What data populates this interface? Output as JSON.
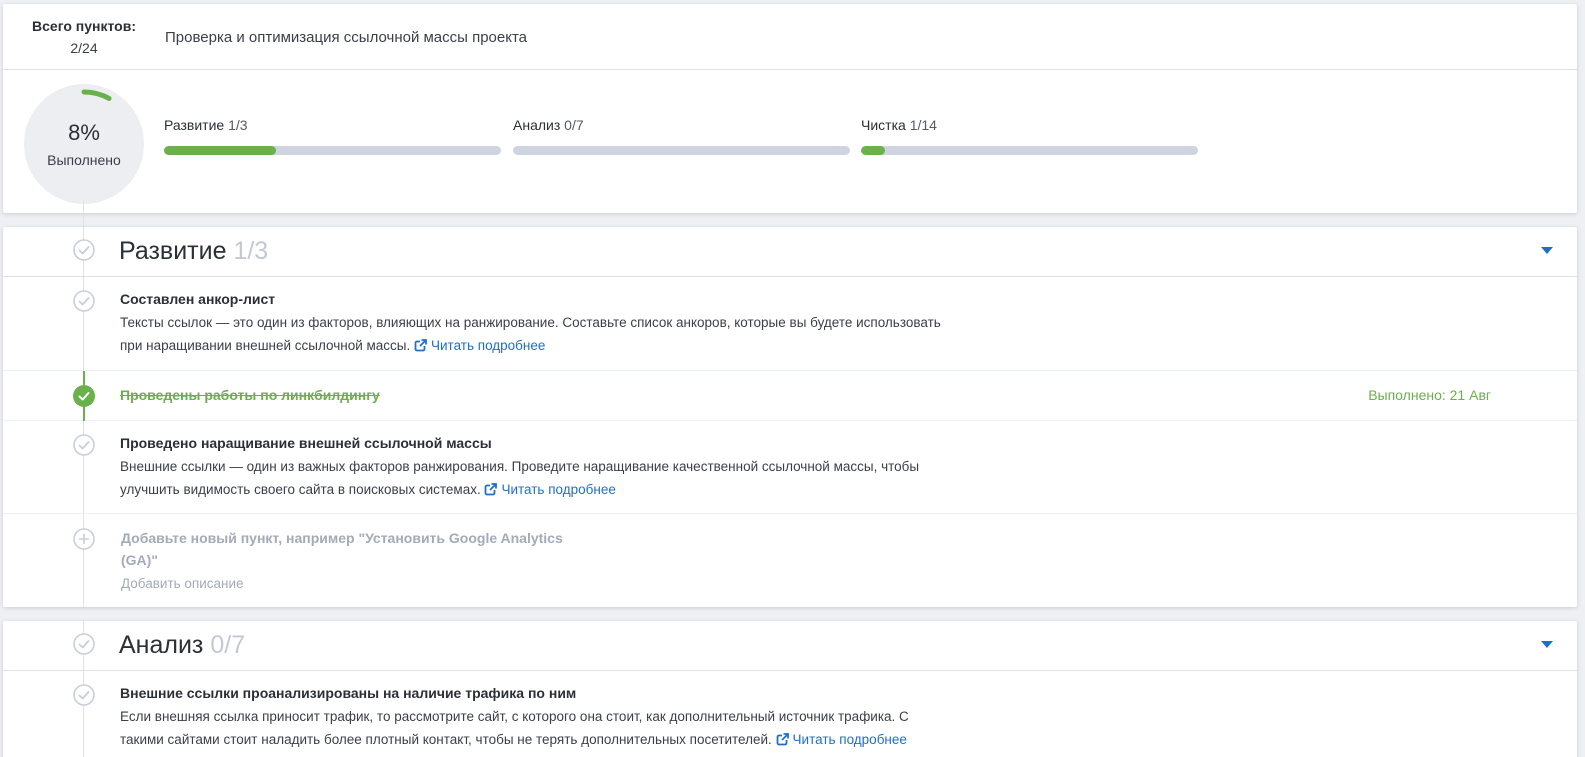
{
  "summary": {
    "total_label": "Всего пунктов:",
    "total_value": "2/24",
    "project_title": "Проверка и оптимизация ссылочной массы проекта",
    "circle_percent": "8%",
    "circle_progress": 0.08,
    "circle_label": "Выполнено",
    "bars": [
      {
        "label": "Развитие",
        "count": "1/3",
        "progress": 0.333
      },
      {
        "label": "Анализ",
        "count": "0/7",
        "progress": 0.0
      },
      {
        "label": "Чистка",
        "count": "1/14",
        "progress": 0.071
      }
    ]
  },
  "sections": [
    {
      "title": "Развитие",
      "count": "1/3",
      "items": [
        {
          "title": "Составлен анкор-лист",
          "desc_line1": "Тексты ссылок — это один из факторов, влияющих на ранжирование. Составьте список анкоров, которые вы будете использовать",
          "desc_line2": "при наращивании внешней ссылочной массы.",
          "read_more": "Читать подробнее"
        },
        {
          "title": "Проведены работы по линкбилдингу",
          "done_label": "Выполнено: 21 Авг"
        },
        {
          "title": "Проведено наращивание внешней ссылочной массы",
          "desc_line1": "Внешние ссылки — один из важных факторов ранжирования. Проведите наращивание качественной ссылочной массы, чтобы",
          "desc_line2": "улучшить видимость своего сайта в поисковых системах.",
          "read_more": "Читать подробнее"
        }
      ],
      "add_item": {
        "title": "Добавьте новый пункт, например \"Установить Google Analytics (GA)\"",
        "desc": "Добавить описание"
      }
    },
    {
      "title": "Анализ",
      "count": "0/7",
      "items": [
        {
          "title": "Внешние ссылки проанализированы на наличие трафика по ним",
          "desc_line1": "Если внешняя ссылка приносит трафик, то рассмотрите сайт, с которого она стоит, как дополнительный источник трафика. С",
          "desc_line2": "такими сайтами стоит наладить более плотный контакт, чтобы не терять дополнительных посетителей.",
          "read_more": "Читать подробнее"
        }
      ]
    }
  ],
  "colors": {
    "accent_blue": "#1e70c6",
    "done_green": "#6ab04c",
    "track_gray": "#ced5e0"
  }
}
